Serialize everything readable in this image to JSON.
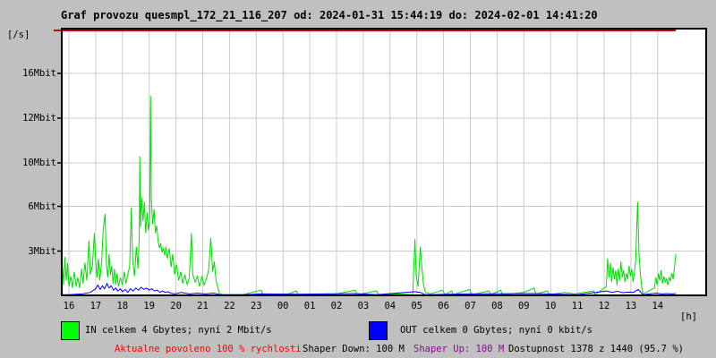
{
  "title": "Graf provozu quesmpl_172_21_116_207 od: 2024-01-31 15:44:19 do: 2024-02-01 14:41:20",
  "unit_label": "[/s]",
  "hour_unit_label": "[h]",
  "colors": {
    "page_bg": "#c0c0c0",
    "plot_bg": "#ffffff",
    "grid": "#cbcbcb",
    "frame": "#000000",
    "in_line": "#00dd00",
    "in_swatch": "#00ff00",
    "out_line": "#0000ff",
    "out_swatch": "#0000ff",
    "availability_line": "#cc0000",
    "allowed_text": "#ff0000",
    "shaper_up_text": "#990099"
  },
  "legend": [
    {
      "name": "IN",
      "swatch": "#00ff00",
      "label": "IN celkem 4 Gbytes; nyní 2 Mbit/s"
    },
    {
      "name": "OUT",
      "swatch": "#0000ff",
      "label": "OUT celkem 0 Gbytes; nyní 0 kbit/s"
    }
  ],
  "footer": {
    "allowed": "Aktualne povoleno 100 % rychlosti",
    "shaper_down": "Shaper Down: 100 M",
    "shaper_up": "Shaper Up: 100 M",
    "availability": "Dostupnost 1378 z 1440 (95.7 %)"
  },
  "chart_data": {
    "type": "line",
    "title": "Graf provozu quesmpl_172_21_116_207",
    "time_from": "2024-01-31 15:44:19",
    "time_to": "2024-02-01 14:41:20",
    "ylabel": "[/s]",
    "xlabel": "[h]",
    "grid": true,
    "legend_position": "bottom",
    "x_ticks": [
      "16",
      "17",
      "18",
      "19",
      "20",
      "21",
      "22",
      "23",
      "00",
      "01",
      "02",
      "03",
      "04",
      "05",
      "06",
      "07",
      "08",
      "09",
      "10",
      "11",
      "12",
      "13",
      "14"
    ],
    "x_tick_hours": [
      16,
      17,
      18,
      19,
      20,
      21,
      22,
      23,
      24,
      25,
      26,
      27,
      28,
      29,
      30,
      31,
      32,
      33,
      34,
      35,
      36,
      37,
      38
    ],
    "x_range_hours": [
      15.73,
      38.68
    ],
    "y_ticks": [
      {
        "label": "16Mbit",
        "value": 16
      },
      {
        "label": "12Mbit",
        "value": 12
      },
      {
        "label": "10Mbit",
        "value": 10
      },
      {
        "label": "6Mbit",
        "value": 6
      },
      {
        "label": "3Mbit",
        "value": 3
      }
    ],
    "y_scale_breakpoints_mbit": [
      0,
      3,
      6,
      10,
      12,
      16
    ],
    "availability_bar": {
      "from_hour": 15.73,
      "to_hour": 38.68
    },
    "series": [
      {
        "name": "IN Mbit/s",
        "color": "#00dd00",
        "points": [
          [
            15.73,
            0.4
          ],
          [
            15.76,
            2.0
          ],
          [
            15.8,
            0.7
          ],
          [
            15.85,
            2.6
          ],
          [
            15.9,
            1.0
          ],
          [
            15.95,
            2.2
          ],
          [
            16.0,
            0.6
          ],
          [
            16.07,
            1.3
          ],
          [
            16.13,
            0.5
          ],
          [
            16.2,
            1.6
          ],
          [
            16.27,
            0.6
          ],
          [
            16.33,
            1.2
          ],
          [
            16.4,
            0.5
          ],
          [
            16.47,
            1.8
          ],
          [
            16.53,
            0.8
          ],
          [
            16.6,
            2.2
          ],
          [
            16.67,
            1.0
          ],
          [
            16.75,
            3.7
          ],
          [
            16.8,
            1.4
          ],
          [
            16.88,
            2.0
          ],
          [
            16.95,
            4.2
          ],
          [
            17.0,
            2.3
          ],
          [
            17.05,
            1.2
          ],
          [
            17.1,
            2.5
          ],
          [
            17.15,
            1.0
          ],
          [
            17.22,
            2.2
          ],
          [
            17.28,
            4.4
          ],
          [
            17.35,
            5.5
          ],
          [
            17.4,
            2.1
          ],
          [
            17.45,
            1.2
          ],
          [
            17.5,
            2.8
          ],
          [
            17.55,
            1.4
          ],
          [
            17.6,
            2.0
          ],
          [
            17.65,
            0.8
          ],
          [
            17.7,
            1.8
          ],
          [
            17.75,
            0.7
          ],
          [
            17.8,
            1.5
          ],
          [
            17.85,
            0.6
          ],
          [
            17.92,
            1.2
          ],
          [
            18.0,
            0.7
          ],
          [
            18.07,
            1.6
          ],
          [
            18.13,
            0.8
          ],
          [
            18.2,
            1.4
          ],
          [
            18.27,
            2.0
          ],
          [
            18.33,
            5.9
          ],
          [
            18.38,
            2.4
          ],
          [
            18.45,
            1.3
          ],
          [
            18.52,
            3.3
          ],
          [
            18.58,
            1.8
          ],
          [
            18.63,
            4.0
          ],
          [
            18.65,
            10.3
          ],
          [
            18.68,
            4.6
          ],
          [
            18.72,
            6.8
          ],
          [
            18.77,
            5.0
          ],
          [
            18.82,
            6.4
          ],
          [
            18.87,
            4.2
          ],
          [
            18.92,
            5.6
          ],
          [
            18.97,
            4.4
          ],
          [
            19.02,
            5.2
          ],
          [
            19.05,
            14.0
          ],
          [
            19.08,
            6.6
          ],
          [
            19.13,
            4.8
          ],
          [
            19.18,
            5.8
          ],
          [
            19.23,
            4.2
          ],
          [
            19.28,
            4.7
          ],
          [
            19.33,
            3.7
          ],
          [
            19.38,
            3.2
          ],
          [
            19.43,
            3.5
          ],
          [
            19.48,
            2.9
          ],
          [
            19.53,
            3.2
          ],
          [
            19.58,
            2.7
          ],
          [
            19.63,
            3.3
          ],
          [
            19.68,
            2.5
          ],
          [
            19.75,
            3.2
          ],
          [
            19.82,
            1.9
          ],
          [
            19.88,
            2.8
          ],
          [
            19.95,
            1.4
          ],
          [
            20.02,
            2.1
          ],
          [
            20.1,
            1.0
          ],
          [
            20.18,
            1.6
          ],
          [
            20.25,
            0.8
          ],
          [
            20.33,
            1.4
          ],
          [
            20.42,
            0.7
          ],
          [
            20.5,
            1.2
          ],
          [
            20.58,
            4.2
          ],
          [
            20.63,
            1.4
          ],
          [
            20.72,
            0.9
          ],
          [
            20.8,
            1.3
          ],
          [
            20.88,
            0.6
          ],
          [
            20.97,
            1.3
          ],
          [
            21.05,
            0.7
          ],
          [
            21.13,
            1.1
          ],
          [
            21.22,
            1.7
          ],
          [
            21.3,
            3.9
          ],
          [
            21.37,
            1.6
          ],
          [
            21.43,
            2.3
          ],
          [
            21.5,
            1.0
          ],
          [
            21.57,
            0.5
          ],
          [
            21.63,
            0.1
          ],
          [
            21.8,
            0.05
          ],
          [
            22.5,
            0.05
          ],
          [
            23.18,
            0.35
          ],
          [
            23.25,
            0.05
          ],
          [
            24.2,
            0.1
          ],
          [
            24.5,
            0.3
          ],
          [
            24.58,
            0.05
          ],
          [
            25.5,
            0.05
          ],
          [
            26.0,
            0.1
          ],
          [
            26.7,
            0.35
          ],
          [
            26.78,
            0.05
          ],
          [
            27.5,
            0.3
          ],
          [
            27.57,
            0.05
          ],
          [
            28.3,
            0.1
          ],
          [
            28.85,
            0.05
          ],
          [
            28.93,
            3.8
          ],
          [
            28.98,
            1.3
          ],
          [
            29.05,
            0.6
          ],
          [
            29.13,
            3.3
          ],
          [
            29.18,
            2.1
          ],
          [
            29.25,
            0.7
          ],
          [
            29.32,
            0.2
          ],
          [
            29.5,
            0.1
          ],
          [
            29.97,
            0.35
          ],
          [
            30.05,
            0.05
          ],
          [
            30.3,
            0.3
          ],
          [
            30.37,
            0.05
          ],
          [
            30.98,
            0.4
          ],
          [
            31.05,
            0.05
          ],
          [
            31.7,
            0.3
          ],
          [
            31.77,
            0.05
          ],
          [
            32.13,
            0.35
          ],
          [
            32.2,
            0.05
          ],
          [
            33.0,
            0.2
          ],
          [
            33.38,
            0.5
          ],
          [
            33.45,
            0.1
          ],
          [
            33.88,
            0.3
          ],
          [
            33.95,
            0.05
          ],
          [
            34.5,
            0.2
          ],
          [
            34.9,
            0.1
          ],
          [
            35.6,
            0.3
          ],
          [
            35.67,
            0.05
          ],
          [
            36.08,
            0.6
          ],
          [
            36.13,
            2.5
          ],
          [
            36.18,
            1.2
          ],
          [
            36.23,
            2.2
          ],
          [
            36.28,
            0.9
          ],
          [
            36.33,
            1.9
          ],
          [
            36.38,
            1.1
          ],
          [
            36.43,
            1.7
          ],
          [
            36.48,
            0.7
          ],
          [
            36.53,
            1.8
          ],
          [
            36.58,
            1.0
          ],
          [
            36.63,
            2.3
          ],
          [
            36.68,
            1.2
          ],
          [
            36.73,
            1.7
          ],
          [
            36.78,
            0.9
          ],
          [
            36.83,
            1.5
          ],
          [
            36.88,
            1.1
          ],
          [
            36.93,
            2.0
          ],
          [
            36.98,
            1.3
          ],
          [
            37.03,
            1.8
          ],
          [
            37.08,
            0.9
          ],
          [
            37.13,
            1.5
          ],
          [
            37.18,
            2.4
          ],
          [
            37.25,
            6.4
          ],
          [
            37.3,
            2.9
          ],
          [
            37.35,
            1.5
          ],
          [
            37.4,
            0.6
          ],
          [
            37.45,
            0.1
          ],
          [
            37.88,
            0.5
          ],
          [
            37.93,
            1.2
          ],
          [
            37.98,
            0.7
          ],
          [
            38.03,
            1.5
          ],
          [
            38.08,
            1.0
          ],
          [
            38.13,
            1.7
          ],
          [
            38.18,
            0.8
          ],
          [
            38.23,
            1.3
          ],
          [
            38.28,
            0.9
          ],
          [
            38.33,
            1.1
          ],
          [
            38.38,
            0.7
          ],
          [
            38.43,
            1.2
          ],
          [
            38.48,
            1.0
          ],
          [
            38.53,
            1.5
          ],
          [
            38.58,
            1.1
          ],
          [
            38.63,
            1.9
          ],
          [
            38.68,
            2.8
          ]
        ]
      },
      {
        "name": "OUT Mbit/s",
        "color": "#0000ff",
        "points": [
          [
            15.73,
            0.05
          ],
          [
            16.0,
            0.05
          ],
          [
            16.5,
            0.1
          ],
          [
            16.8,
            0.2
          ],
          [
            17.0,
            0.45
          ],
          [
            17.08,
            0.7
          ],
          [
            17.17,
            0.4
          ],
          [
            17.25,
            0.65
          ],
          [
            17.33,
            0.45
          ],
          [
            17.42,
            0.8
          ],
          [
            17.5,
            0.5
          ],
          [
            17.58,
            0.65
          ],
          [
            17.67,
            0.35
          ],
          [
            17.75,
            0.5
          ],
          [
            17.83,
            0.3
          ],
          [
            17.92,
            0.45
          ],
          [
            18.0,
            0.25
          ],
          [
            18.1,
            0.4
          ],
          [
            18.2,
            0.2
          ],
          [
            18.3,
            0.45
          ],
          [
            18.4,
            0.3
          ],
          [
            18.5,
            0.5
          ],
          [
            18.6,
            0.35
          ],
          [
            18.7,
            0.55
          ],
          [
            18.8,
            0.4
          ],
          [
            18.9,
            0.5
          ],
          [
            19.0,
            0.35
          ],
          [
            19.1,
            0.45
          ],
          [
            19.2,
            0.3
          ],
          [
            19.3,
            0.35
          ],
          [
            19.4,
            0.2
          ],
          [
            19.5,
            0.3
          ],
          [
            19.6,
            0.2
          ],
          [
            19.7,
            0.25
          ],
          [
            19.8,
            0.15
          ],
          [
            19.95,
            0.1
          ],
          [
            20.2,
            0.2
          ],
          [
            20.5,
            0.1
          ],
          [
            20.8,
            0.15
          ],
          [
            21.1,
            0.1
          ],
          [
            21.4,
            0.15
          ],
          [
            21.65,
            0.05
          ],
          [
            22.5,
            0.05
          ],
          [
            23.2,
            0.1
          ],
          [
            24.5,
            0.08
          ],
          [
            26.7,
            0.12
          ],
          [
            27.5,
            0.05
          ],
          [
            28.93,
            0.25
          ],
          [
            29.13,
            0.2
          ],
          [
            29.3,
            0.05
          ],
          [
            30.98,
            0.1
          ],
          [
            33.38,
            0.12
          ],
          [
            35.0,
            0.05
          ],
          [
            36.1,
            0.3
          ],
          [
            36.3,
            0.2
          ],
          [
            36.5,
            0.28
          ],
          [
            36.7,
            0.18
          ],
          [
            36.9,
            0.22
          ],
          [
            37.1,
            0.2
          ],
          [
            37.27,
            0.4
          ],
          [
            37.45,
            0.05
          ],
          [
            37.95,
            0.15
          ],
          [
            38.15,
            0.1
          ],
          [
            38.35,
            0.12
          ],
          [
            38.55,
            0.1
          ],
          [
            38.68,
            0.12
          ]
        ]
      }
    ]
  }
}
